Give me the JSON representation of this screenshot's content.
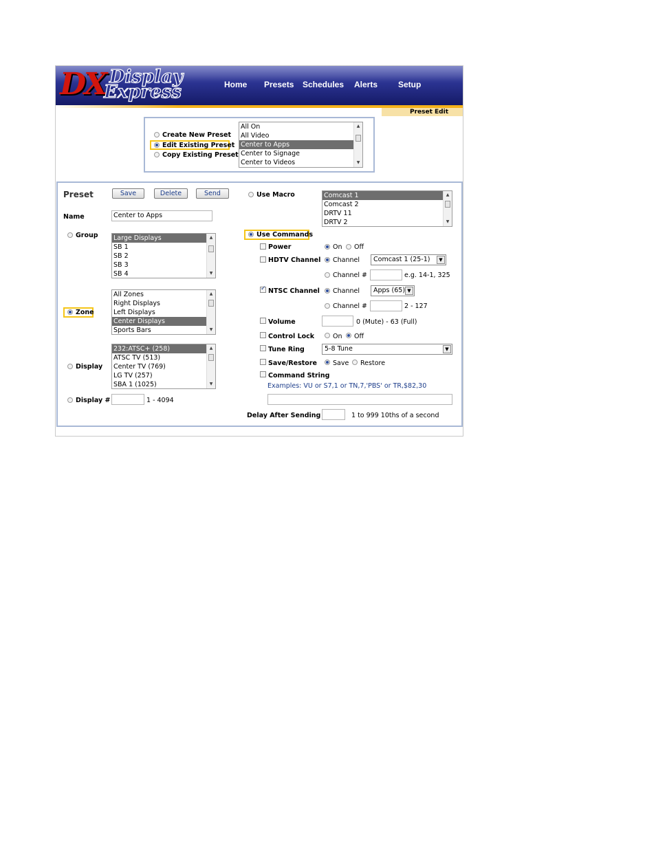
{
  "app": {
    "logo_mark": "DX",
    "logo_line1": "Display",
    "logo_line2": "Express",
    "nav": [
      "Home",
      "Presets",
      "Schedules",
      "Alerts",
      "Setup"
    ],
    "page_tab": "Preset Edit"
  },
  "top_selector": {
    "options": [
      "Create New Preset",
      "Edit Existing Preset",
      "Copy Existing Preset"
    ],
    "selected_index": 1,
    "presets": [
      "All On",
      "All Video",
      "Center to Apps",
      "Center to Signage",
      "Center to Videos"
    ],
    "selected_preset": 2
  },
  "preset": {
    "title": "Preset",
    "buttons": {
      "save": "Save",
      "delete": "Delete",
      "send": "Send"
    },
    "name_label": "Name",
    "name_value": "Center to Apps",
    "group_label": "Group",
    "groups": [
      "Large Displays",
      "SB 1",
      "SB 2",
      "SB 3",
      "SB 4"
    ],
    "zone_label": "Zone",
    "zones": [
      "All Zones",
      "Right Displays",
      "Left Displays",
      "Center Displays",
      "Sports Bars"
    ],
    "display_label": "Display",
    "displays": [
      "232:ATSC+ (258)",
      "ATSC TV (513)",
      "Center TV (769)",
      "LG TV (257)",
      "SBA 1 (1025)"
    ],
    "display_num_label": "Display #",
    "display_num_value": "",
    "display_num_range": "1 - 4094"
  },
  "commands": {
    "use_macro_label": "Use Macro",
    "macros": [
      "Comcast 1",
      "Comcast 2",
      "DRTV 11",
      "DRTV 2"
    ],
    "use_commands_label": "Use Commands",
    "power_label": "Power",
    "on_label": "On",
    "off_label": "Off",
    "hdtv_label": "HDTV Channel",
    "channel_label": "Channel",
    "hdtv_channel_value": "Comcast 1 (25-1)",
    "channel_num_label": "Channel #",
    "hdtv_hint": "e.g. 14-1, 325",
    "ntsc_label": "NTSC Channel",
    "ntsc_channel_value": "Apps (65)",
    "ntsc_hint": "2 - 127",
    "volume_label": "Volume",
    "volume_hint": "0 (Mute) - 63 (Full)",
    "control_lock_label": "Control Lock",
    "tune_ring_label": "Tune Ring",
    "tune_ring_value": "5-8 Tune",
    "save_restore_label": "Save/Restore",
    "save_label": "Save",
    "restore_label": "Restore",
    "command_string_label": "Command String",
    "examples": "Examples: VU or S7,1 or TN,7,'PBS' or TR,$82,30",
    "delay_label": "Delay After Sending",
    "delay_hint": "1 to 999 10ths of a second"
  }
}
